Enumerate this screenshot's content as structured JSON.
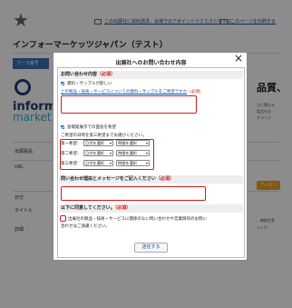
{
  "background": {
    "toplinks": [
      {
        "label": "この出展社に資料請求、会場でのアポイントリクエストをする"
      },
      {
        "label": "このページを印刷する"
      }
    ],
    "company_name": "インフォーマーケッツジャパン（テスト）",
    "booth_label": "ブース番号",
    "logo_text_1": "inform",
    "logo_text_2": "market",
    "right_heading": "品質、",
    "right_lines": [
      "さに関わる",
      "製品を含",
      "グライジ"
    ],
    "labels": [
      {
        "text": "出展製品"
      },
      {
        "text": "URL"
      },
      {
        "text": "日付"
      },
      {
        "text": "タイトル"
      },
      {
        "text": "詳細"
      }
    ],
    "present_badge": "プレゼン",
    "right_bottom": [
      "、機能性食",
      "ントや"
    ]
  },
  "modal": {
    "title": "出展社へのお問い合わせ内容",
    "close_label": "×",
    "sections": {
      "inquiry": {
        "heading": "お問い合わせ内容",
        "required": "（必須）",
        "option_request": "資料・サンプルが欲しい",
        "request_link": "どの製品・技術・サービスについての資料・サンプルをご希望ですか",
        "request_req": "（必須）",
        "option_meeting": "会場発展示での面会を希望",
        "meeting_hint": "ご希望の日時を第三希望までお選びください。",
        "preferences": [
          {
            "label": "第一希望：",
            "date": "日付を選択",
            "time": "時間を選択"
          },
          {
            "label": "第二希望：",
            "date": "日付を選択",
            "time": "時間を選択"
          },
          {
            "label": "第三希望：",
            "date": "日付を選択",
            "time": "時間を選択"
          }
        ]
      },
      "message": {
        "heading": "問い合わせ理由とメッセージをご記入ください",
        "required": "（必須）"
      },
      "agreement": {
        "heading": "以下に同意してください。",
        "required": "（必須）",
        "text_1": "出展社の製品・技術・サービスに関係のない問い合わせや営業目的のお問い",
        "text_2": "合わせはご遠慮ください。"
      }
    },
    "submit_label": "送信する"
  }
}
